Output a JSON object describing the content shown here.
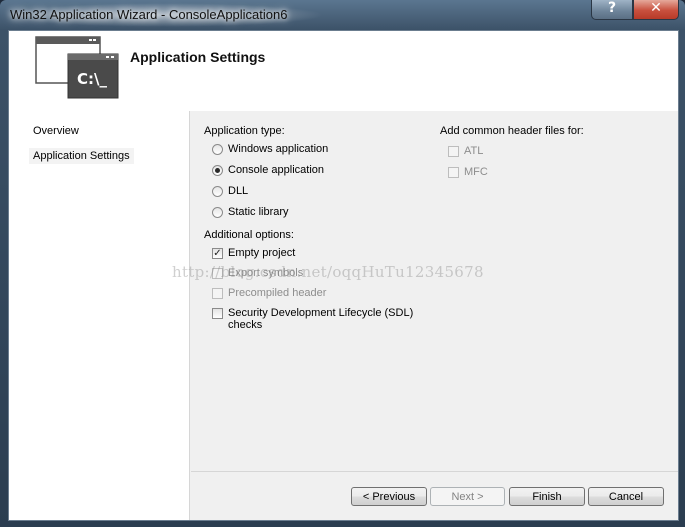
{
  "window": {
    "title": "Win32 Application Wizard - ConsoleApplication6",
    "help_glyph": "?",
    "close_glyph": "✕"
  },
  "banner": {
    "title": "Application Settings",
    "icon_text": "C:\\_"
  },
  "nav": {
    "items": [
      {
        "label": "Overview",
        "selected": false
      },
      {
        "label": "Application Settings",
        "selected": true
      }
    ]
  },
  "app_type": {
    "label": "Application type:",
    "options": [
      {
        "label": "Windows application",
        "selected": false
      },
      {
        "label": "Console application",
        "selected": true
      },
      {
        "label": "DLL",
        "selected": false
      },
      {
        "label": "Static library",
        "selected": false
      }
    ]
  },
  "additional": {
    "label": "Additional options:",
    "options": [
      {
        "label": "Empty project",
        "checked": true,
        "enabled": true
      },
      {
        "label": "Export symbols",
        "checked": false,
        "enabled": false
      },
      {
        "label": "Precompiled header",
        "checked": false,
        "enabled": false
      },
      {
        "label": "Security Development Lifecycle (SDL)",
        "label2": "checks",
        "checked": false,
        "enabled": true
      }
    ]
  },
  "headers": {
    "label": "Add common header files for:",
    "options": [
      {
        "label": "ATL",
        "checked": false,
        "enabled": false
      },
      {
        "label": "MFC",
        "checked": false,
        "enabled": false
      }
    ]
  },
  "buttons": {
    "previous": "< Previous",
    "next": "Next >",
    "finish": "Finish",
    "cancel": "Cancel"
  },
  "watermark": "http://blog.csdn.net/oqqHuTu12345678",
  "colors": {
    "title_bar": "#3c5268",
    "client_bg": "#f0f0f0",
    "close_button": "#c8503e"
  }
}
